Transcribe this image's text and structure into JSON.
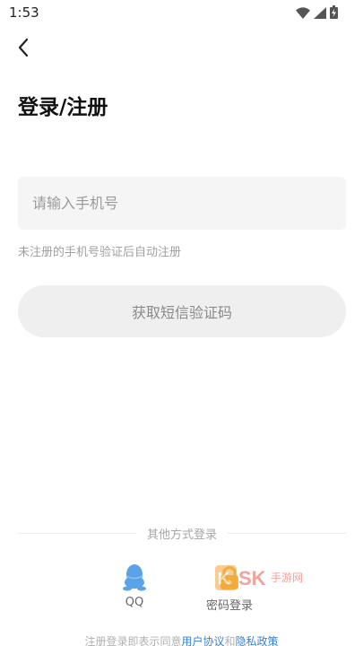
{
  "status_bar": {
    "time": "1:53"
  },
  "header": {
    "back_icon": "chevron-left-icon",
    "title": "登录/注册"
  },
  "form": {
    "phone_placeholder": "请输入手机号",
    "phone_value": "",
    "hint": "未注册的手机号验证后自动注册",
    "sms_button_label": "获取短信验证码"
  },
  "other_login": {
    "divider_text": "其他方式登录",
    "options": [
      {
        "label": "QQ",
        "icon": "qq-penguin-icon"
      },
      {
        "label": "密码登录",
        "icon": "password-icon"
      }
    ]
  },
  "agreement": {
    "prefix": "注册登录即表示同意",
    "user_agreement": "用户协议",
    "connector": "和",
    "privacy_policy": "隐私政策"
  },
  "watermark": {
    "text": "KSK 手游网"
  },
  "colors": {
    "link": "#3b7fd0",
    "qq_blue": "#5aa3e8",
    "button_bg": "#efefef",
    "input_bg": "#f5f5f5"
  }
}
